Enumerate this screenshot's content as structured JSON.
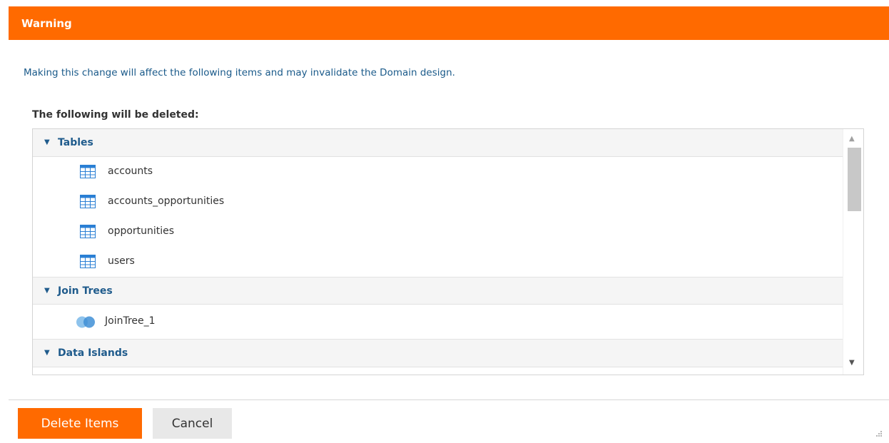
{
  "dialog": {
    "title": "Warning",
    "message": "Making this change will affect the following items and may invalidate the Domain design.",
    "subheading": "The following will be deleted:",
    "groups": [
      {
        "label": "Tables",
        "icon": "table-icon",
        "items": [
          "accounts",
          "accounts_opportunities",
          "opportunities",
          "users"
        ]
      },
      {
        "label": "Join Trees",
        "icon": "join-tree-icon",
        "items": [
          "JoinTree_1"
        ]
      },
      {
        "label": "Data Islands",
        "icon": "data-island-icon",
        "items": []
      }
    ],
    "buttons": {
      "delete_label": "Delete Items",
      "cancel_label": "Cancel"
    }
  },
  "colors": {
    "accent": "#ff6a00",
    "link_text": "#1f5b8c",
    "table_icon": "#2a7fd4"
  }
}
